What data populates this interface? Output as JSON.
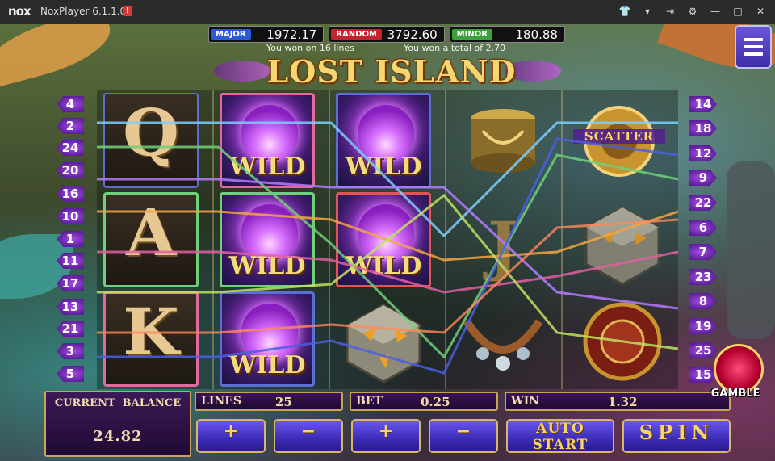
{
  "window": {
    "logo": "nox",
    "title": "NoxPlayer 6.1.1.0",
    "warning": "!",
    "icons": [
      "shirt-icon",
      "chevron-down-icon",
      "pin-icon",
      "gear-icon",
      "minimize-icon",
      "maximize-icon",
      "close-icon"
    ]
  },
  "jackpots": [
    {
      "tag": "MAJOR",
      "value": "1972.17",
      "color": "#2a5bd6"
    },
    {
      "tag": "RANDOM",
      "value": "3792.60",
      "color": "#c4242e"
    },
    {
      "tag": "MINOR",
      "value": "180.88",
      "color": "#39a23a"
    }
  ],
  "messages": {
    "left": "You won on 16 lines",
    "right": "You won a total of 2.70"
  },
  "game_title": "LOST ISLAND",
  "left_lines": [
    "4",
    "2",
    "24",
    "20",
    "16",
    "10",
    "1",
    "11",
    "17",
    "13",
    "21",
    "3",
    "5"
  ],
  "right_lines": [
    "14",
    "18",
    "12",
    "9",
    "22",
    "6",
    "7",
    "23",
    "8",
    "19",
    "25",
    "15"
  ],
  "reels": {
    "col1": [
      "Q",
      "A",
      "K"
    ],
    "wild_label": "WILD",
    "scatter_label": "SCATTER"
  },
  "panel": {
    "balance_label": "CURRENT  BALANCE",
    "balance": "24.82",
    "lines_label": "LINES",
    "lines": "25",
    "bet_label": "BET",
    "bet": "0.25",
    "win_label": "WIN",
    "win": "1.32",
    "plus": "+",
    "minus": "−",
    "auto_start": "AUTO START",
    "spin": "SPIN",
    "gamble": "GAMBLE"
  },
  "menu_icon": "hamburger-menu-icon"
}
